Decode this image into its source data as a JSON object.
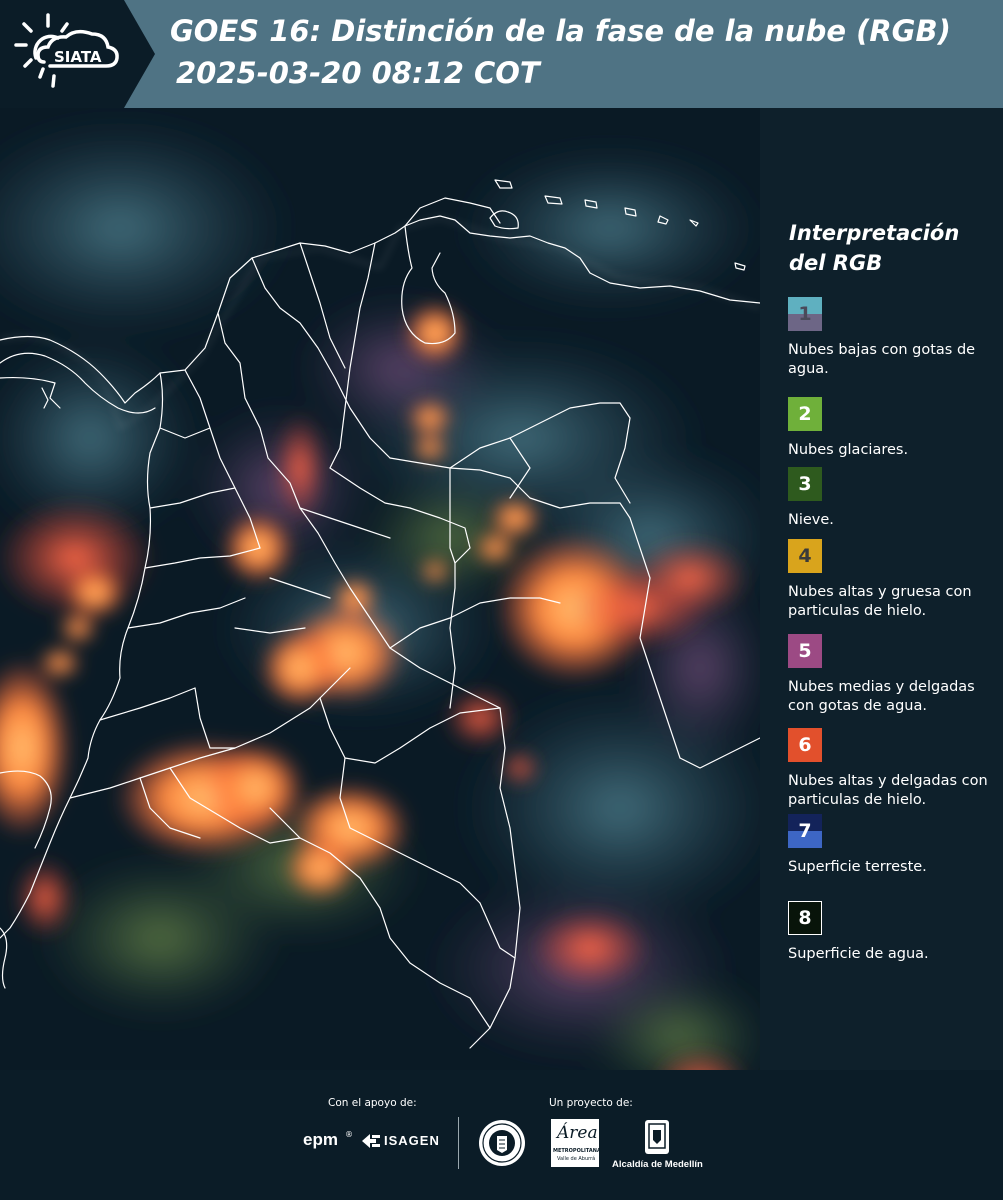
{
  "header": {
    "logo_text": "SIATA",
    "title_line1": "GOES 16: Distinción de la fase de la nube (RGB)",
    "title_line2": "2025-03-20 08:12 COT"
  },
  "map": {
    "description_colors": {
      "background": "#0a1b26",
      "border_lines": "#ffffff",
      "storm_orange": "#ff7a3a",
      "storm_core": "#ffb347"
    }
  },
  "legend": {
    "title": "Interpretación del RGB",
    "items": [
      {
        "number": "1",
        "label": "Nubes bajas con gotas de agua.",
        "color_top": "#5fb0c0",
        "color_bottom": "#6d6686",
        "text_color": "#4a4a5a"
      },
      {
        "number": "2",
        "label": "Nubes glaciares.",
        "color_top": "#6fb03a",
        "color_bottom": "#6fb03a",
        "text_color": "#ffffff"
      },
      {
        "number": "3",
        "label": "Nieve.",
        "color_top": "#2e5a1e",
        "color_bottom": "#2e5a1e",
        "text_color": "#ffffff"
      },
      {
        "number": "4",
        "label": "Nubes altas y gruesa con particulas de hielo.",
        "color_top": "#d9a41c",
        "color_bottom": "#d9a41c",
        "text_color": "#3a3a3a"
      },
      {
        "number": "5",
        "label": "Nubes medias y delgadas con gotas de agua.",
        "color_top": "#9c4a84",
        "color_bottom": "#9c4a84",
        "text_color": "#ffffff"
      },
      {
        "number": "6",
        "label": "Nubes altas y delgadas con particulas de hielo.",
        "color_top": "#e2502c",
        "color_bottom": "#e2502c",
        "text_color": "#ffffff"
      },
      {
        "number": "7",
        "label": "Superficie terreste.",
        "color_top": "#13235a",
        "color_bottom": "#3d66c4",
        "text_color": "#ffffff"
      },
      {
        "number": "8",
        "label": "Superficie de agua.",
        "color_top": "#08140a",
        "color_bottom": "#08140a",
        "text_color": "#ffffff"
      }
    ]
  },
  "footer": {
    "support_label": "Con el apoyo de:",
    "project_label": "Un proyecto de:",
    "epm": "epm",
    "isagen": "ISAGEN",
    "area_metro_name": "Área",
    "area_metro_sub": "METROPOLITANA",
    "area_metro_sub2": "Valle de Aburrá",
    "alcaldia": "Alcaldía de Medellín"
  }
}
